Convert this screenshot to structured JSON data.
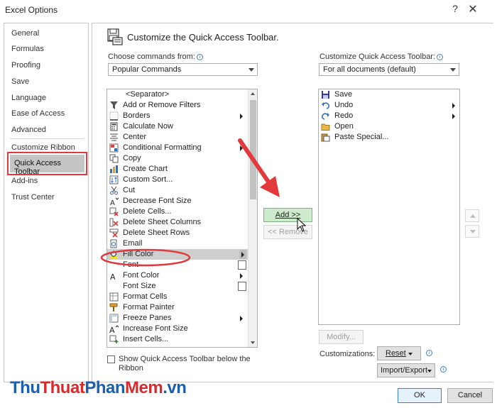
{
  "window": {
    "title": "Excel Options",
    "help": "?",
    "close": "✕"
  },
  "nav": {
    "items": [
      "General",
      "Formulas",
      "Proofing",
      "Save",
      "Language",
      "Ease of Access",
      "Advanced",
      "Customize Ribbon",
      "Quick Access Toolbar",
      "Add-ins",
      "Trust Center"
    ],
    "selected": "Quick Access Toolbar"
  },
  "header": {
    "title": "Customize the Quick Access Toolbar."
  },
  "left": {
    "label": "Choose commands from:",
    "dropdown": "Popular Commands",
    "commands": [
      {
        "label": "<Separator>",
        "icon": "none"
      },
      {
        "label": "Add or Remove Filters",
        "icon": "filter-icon"
      },
      {
        "label": "Borders",
        "icon": "borders-icon",
        "submenu": "arrow"
      },
      {
        "label": "Calculate Now",
        "icon": "calculator-icon"
      },
      {
        "label": "Center",
        "icon": "center-align-icon"
      },
      {
        "label": "Conditional Formatting",
        "icon": "conditional-formatting-icon",
        "submenu": "arrow"
      },
      {
        "label": "Copy",
        "icon": "copy-icon"
      },
      {
        "label": "Create Chart",
        "icon": "chart-icon"
      },
      {
        "label": "Custom Sort...",
        "icon": "sort-icon"
      },
      {
        "label": "Cut",
        "icon": "scissors-icon"
      },
      {
        "label": "Decrease Font Size",
        "icon": "decrease-font-icon"
      },
      {
        "label": "Delete Cells...",
        "icon": "delete-cells-icon"
      },
      {
        "label": "Delete Sheet Columns",
        "icon": "delete-columns-icon"
      },
      {
        "label": "Delete Sheet Rows",
        "icon": "delete-rows-icon"
      },
      {
        "label": "Email",
        "icon": "email-icon"
      },
      {
        "label": "Fill Color",
        "icon": "fill-color-icon",
        "submenu": "arrow"
      },
      {
        "label": "Font",
        "icon": "none",
        "submenu": "combo"
      },
      {
        "label": "Font Color",
        "icon": "font-color-icon",
        "submenu": "arrow"
      },
      {
        "label": "Font Size",
        "icon": "none",
        "submenu": "combo"
      },
      {
        "label": "Format Cells",
        "icon": "format-cells-icon"
      },
      {
        "label": "Format Painter",
        "icon": "format-painter-icon"
      },
      {
        "label": "Freeze Panes",
        "icon": "freeze-panes-icon",
        "submenu": "arrow"
      },
      {
        "label": "Increase Font Size",
        "icon": "increase-font-icon"
      },
      {
        "label": "Insert Cells...",
        "icon": "insert-cells-icon"
      }
    ],
    "selected": "Fill Color",
    "checkbox_label_1": "Show Quick Access Toolbar below the",
    "checkbox_label_2": "Ribbon"
  },
  "middle": {
    "add": "Add >>",
    "remove": "<< Remove"
  },
  "right": {
    "label": "Customize Quick Access Toolbar:",
    "dropdown": "For all documents (default)",
    "items": [
      {
        "label": "Save",
        "icon": "save-icon"
      },
      {
        "label": "Undo",
        "icon": "undo-icon",
        "submenu": "arrow"
      },
      {
        "label": "Redo",
        "icon": "redo-icon",
        "submenu": "arrow"
      },
      {
        "label": "Open",
        "icon": "folder-icon"
      },
      {
        "label": "Paste Special...",
        "icon": "paste-special-icon"
      }
    ],
    "modify": "Modify...",
    "customizations_label": "Customizations:",
    "reset": "Reset",
    "import_export": "Import/Export"
  },
  "footer": {
    "ok": "OK",
    "cancel": "Cancel"
  },
  "watermark": {
    "part1": "Thu",
    "part2": "Thuat",
    "part3": "Phan",
    "part4": "Mem",
    "part5": ".vn"
  },
  "colors": {
    "accent_red": "#e0393e",
    "selected_bg": "#c5c5c5",
    "add_button": "#cdeacd",
    "primary_border": "#3c7fc4",
    "watermark_blue": "#1b5fae",
    "watermark_red": "#d92b2b"
  }
}
